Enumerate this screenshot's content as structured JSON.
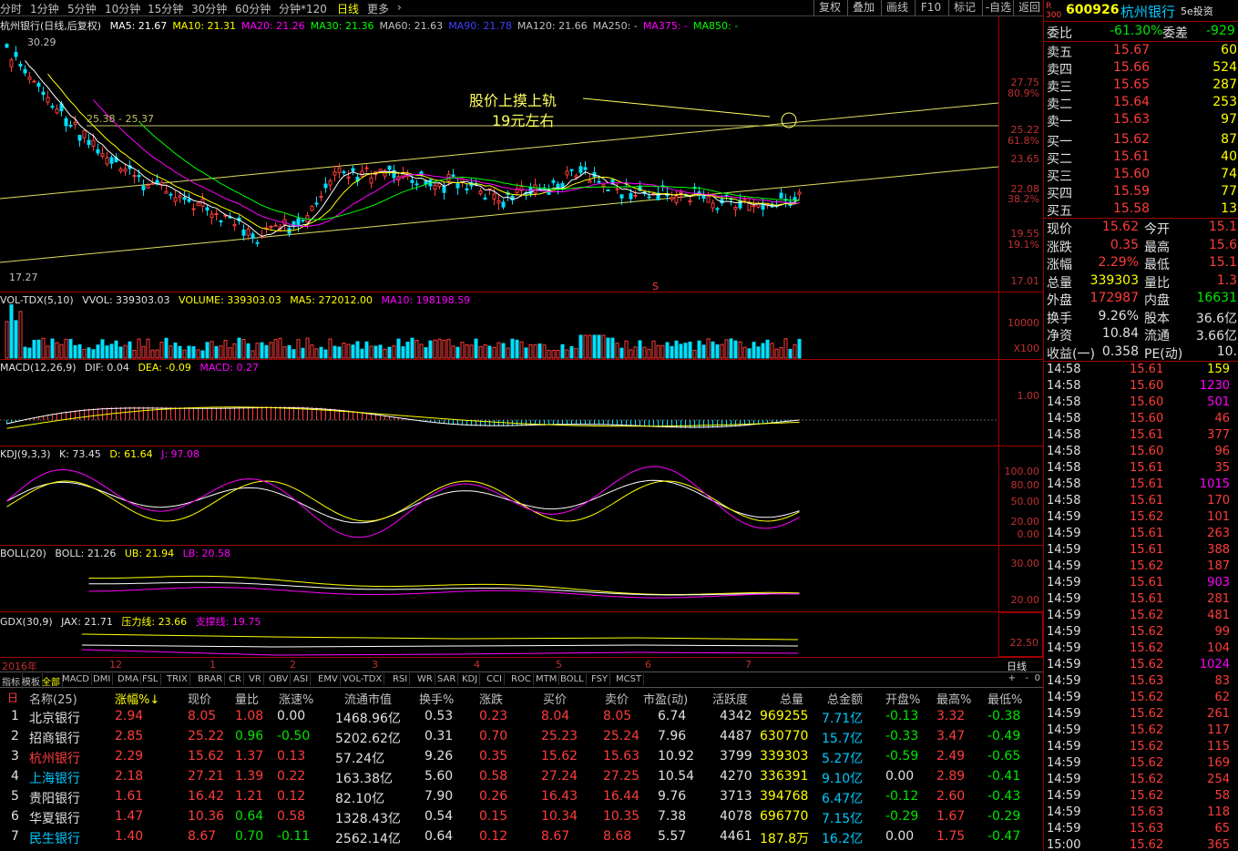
{
  "periods": [
    "分时",
    "1分钟",
    "5分钟",
    "10分钟",
    "15分钟",
    "30分钟",
    "60分钟",
    "分钟*120",
    "日线",
    "更多"
  ],
  "active_period": "日线",
  "toolbar_right": [
    "复权",
    "叠加",
    "画线",
    "F10",
    "标记",
    "-自选",
    "返回"
  ],
  "main_panel": {
    "stock_label": "杭州银行(日线,后复权)",
    "ma": [
      {
        "name": "MA5",
        "value": "21.67",
        "color": "#ffffff"
      },
      {
        "name": "MA10",
        "value": "21.31",
        "color": "#ffff00"
      },
      {
        "name": "MA20",
        "value": "21.26",
        "color": "#ff00ff"
      },
      {
        "name": "MA30",
        "value": "21.36",
        "color": "#00ff00"
      },
      {
        "name": "MA60",
        "value": "21.63",
        "color": "#c0c0c0"
      },
      {
        "name": "MA90",
        "value": "21.78",
        "color": "#4040ff"
      },
      {
        "name": "MA120",
        "value": "21.66",
        "color": "#c0c0c0"
      },
      {
        "name": "MA250",
        "value": "-",
        "color": "#c0c0c0"
      },
      {
        "name": "MA375",
        "value": "-",
        "color": "#ff00ff"
      },
      {
        "name": "MA850",
        "value": "-",
        "color": "#00ff00"
      }
    ],
    "high_label": "30.29",
    "low_label": "17.27",
    "range_label": "25.38 - 25.37",
    "annotation_line1": "股价上摸上轨",
    "annotation_line2": "19元左右",
    "axis": [
      "27.75",
      "80.9%",
      "25.22",
      "61.8%",
      "23.65",
      "22.08",
      "38.2%",
      "19.55",
      "19.1%",
      "17.01"
    ]
  },
  "vol_panel": {
    "label": "VOL-TDX(5,10)",
    "vvol": "VVOL: 339303.03",
    "volume": "VOLUME: 339303.03",
    "ma5": "MA5: 272012.00",
    "ma10": "MA10: 198198.59",
    "axis": [
      "10000",
      "X100"
    ]
  },
  "macd_panel": {
    "label": "MACD(12,26,9)",
    "dif": "DIF: 0.04",
    "dea": "DEA: -0.09",
    "macd": "MACD: 0.27",
    "axis": [
      "1.00"
    ]
  },
  "kdj_panel": {
    "label": "KDJ(9,3,3)",
    "k": "K: 73.45",
    "d": "D: 61.64",
    "j": "J: 97.08",
    "axis": [
      "100.00",
      "80.00",
      "50.00",
      "20.00",
      "0.00"
    ]
  },
  "boll_panel": {
    "label": "BOLL(20)",
    "boll": "BOLL: 21.26",
    "ub": "UB: 21.94",
    "lb": "LB: 20.58",
    "axis": [
      "30.00",
      "20.00"
    ]
  },
  "gdx_panel": {
    "label": "GDX(30,9)",
    "jax": "JAX: 21.71",
    "pressure": "压力线: 23.66",
    "support": "支撑线: 19.75",
    "axis": [
      "22.50"
    ]
  },
  "date_axis": [
    "2016年",
    "12",
    "1",
    "2",
    "3",
    "4",
    "5",
    "6",
    "7"
  ],
  "date_axis_right": "日线",
  "indicator_tabs": [
    "指标",
    "模板",
    "全部",
    "MACD",
    "DMI",
    "DMA",
    "FSL",
    "TRIX",
    "BRAR",
    "CR",
    "VR",
    "OBV",
    "ASI",
    "EMV",
    "VOL-TDX",
    "RSI",
    "WR",
    "SAR",
    "KDJ",
    "CCI",
    "ROC",
    "MTM",
    "BOLL",
    "FSY",
    "MCST"
  ],
  "active_tab": "全部",
  "table": {
    "headers": [
      "名称(25)",
      "涨幅%↓",
      "现价",
      "量比",
      "涨速%",
      "流通市值",
      "换手%",
      "涨跌",
      "买价",
      "卖价",
      "市盈(动)",
      "活跃度",
      "总量",
      "总金额",
      "开盘%",
      "最高%",
      "最低%"
    ],
    "rows": [
      {
        "idx": "1",
        "name": "北京银行",
        "chg": "2.94",
        "price": "8.05",
        "lb": "1.08",
        "speed": "0.00",
        "mv": "1468.96亿",
        "turn": "0.53",
        "diff": "0.23",
        "bid": "8.04",
        "ask": "8.05",
        "pe": "6.74",
        "act": "4342",
        "vol": "969255",
        "amt": "7.71亿",
        "open": "-0.13",
        "high": "3.32",
        "low": "-0.38"
      },
      {
        "idx": "2",
        "name": "招商银行",
        "chg": "2.85",
        "price": "25.22",
        "lb": "0.96",
        "speed": "-0.50",
        "mv": "5202.62亿",
        "turn": "0.31",
        "diff": "0.70",
        "bid": "25.23",
        "ask": "25.24",
        "pe": "7.96",
        "act": "4487",
        "vol": "630770",
        "amt": "15.7亿",
        "open": "-0.33",
        "high": "3.47",
        "low": "-0.49"
      },
      {
        "idx": "3",
        "name": "杭州银行",
        "chg": "2.29",
        "price": "15.62",
        "lb": "1.37",
        "speed": "0.13",
        "mv": "57.24亿",
        "turn": "9.26",
        "diff": "0.35",
        "bid": "15.62",
        "ask": "15.63",
        "pe": "10.92",
        "act": "3799",
        "vol": "339303",
        "amt": "5.27亿",
        "open": "-0.59",
        "high": "2.49",
        "low": "-0.65"
      },
      {
        "idx": "4",
        "name": "上海银行",
        "chg": "2.18",
        "price": "27.21",
        "lb": "1.39",
        "speed": "0.22",
        "mv": "163.38亿",
        "turn": "5.60",
        "diff": "0.58",
        "bid": "27.24",
        "ask": "27.25",
        "pe": "10.54",
        "act": "4270",
        "vol": "336391",
        "amt": "9.10亿",
        "open": "0.00",
        "high": "2.89",
        "low": "-0.41"
      },
      {
        "idx": "5",
        "name": "贵阳银行",
        "chg": "1.61",
        "price": "16.42",
        "lb": "1.21",
        "speed": "0.12",
        "mv": "82.10亿",
        "turn": "7.90",
        "diff": "0.26",
        "bid": "16.43",
        "ask": "16.44",
        "pe": "9.76",
        "act": "3713",
        "vol": "394768",
        "amt": "6.47亿",
        "open": "-0.12",
        "high": "2.60",
        "low": "-0.43"
      },
      {
        "idx": "6",
        "name": "华夏银行",
        "chg": "1.47",
        "price": "10.36",
        "lb": "0.64",
        "speed": "0.58",
        "mv": "1328.43亿",
        "turn": "0.54",
        "diff": "0.15",
        "bid": "10.34",
        "ask": "10.35",
        "pe": "7.38",
        "act": "4078",
        "vol": "696770",
        "amt": "7.15亿",
        "open": "-0.29",
        "high": "1.67",
        "low": "-0.29"
      },
      {
        "idx": "7",
        "name": "民生银行",
        "chg": "1.40",
        "price": "8.67",
        "lb": "0.70",
        "speed": "-0.11",
        "mv": "2562.14亿",
        "turn": "0.64",
        "diff": "0.12",
        "bid": "8.67",
        "ask": "8.68",
        "pe": "5.57",
        "act": "4461",
        "vol": "187.8万",
        "amt": "16.2亿",
        "open": "0.00",
        "high": "1.75",
        "low": "-0.47"
      }
    ]
  },
  "quote": {
    "code": "600926",
    "name": "杭州银行",
    "watermark": "5e投资",
    "weibi_label": "委比",
    "weibi": "-61.30%",
    "weicha_label": "委差",
    "weicha": "-929",
    "asks": [
      {
        "label": "卖五",
        "price": "15.67",
        "vol": "60"
      },
      {
        "label": "卖四",
        "price": "15.66",
        "vol": "524"
      },
      {
        "label": "卖三",
        "price": "15.65",
        "vol": "287"
      },
      {
        "label": "卖二",
        "price": "15.64",
        "vol": "253"
      },
      {
        "label": "卖一",
        "price": "15.63",
        "vol": "97"
      }
    ],
    "bids": [
      {
        "label": "买一",
        "price": "15.62",
        "vol": "87"
      },
      {
        "label": "买二",
        "price": "15.61",
        "vol": "40"
      },
      {
        "label": "买三",
        "price": "15.60",
        "vol": "74"
      },
      {
        "label": "买四",
        "price": "15.59",
        "vol": "77"
      },
      {
        "label": "买五",
        "price": "15.58",
        "vol": "13"
      }
    ],
    "stats": [
      {
        "l1": "现价",
        "v1": "15.62",
        "l2": "今开",
        "v2": "15.1",
        "c1": "red",
        "c2": "red"
      },
      {
        "l1": "涨跌",
        "v1": "0.35",
        "l2": "最高",
        "v2": "15.6",
        "c1": "red",
        "c2": "red"
      },
      {
        "l1": "涨幅",
        "v1": "2.29%",
        "l2": "最低",
        "v2": "15.1",
        "c1": "red",
        "c2": "red"
      },
      {
        "l1": "总量",
        "v1": "339303",
        "l2": "量比",
        "v2": "1.3",
        "c1": "yellow",
        "c2": "red"
      },
      {
        "l1": "外盘",
        "v1": "172987",
        "l2": "内盘",
        "v2": "16631",
        "c1": "red",
        "c2": "green"
      },
      {
        "l1": "换手",
        "v1": "9.26%",
        "l2": "股本",
        "v2": "36.6亿",
        "c1": "white",
        "c2": "white"
      },
      {
        "l1": "净资",
        "v1": "10.84",
        "l2": "流通",
        "v2": "3.66亿",
        "c1": "white",
        "c2": "white"
      },
      {
        "l1": "收益(一)",
        "v1": "0.358",
        "l2": "PE(动)",
        "v2": "10.",
        "c1": "white",
        "c2": "white"
      }
    ],
    "ticks": [
      [
        "14:58",
        "15.61",
        "159",
        "yellow"
      ],
      [
        "14:58",
        "15.60",
        "1230",
        "magenta"
      ],
      [
        "14:58",
        "15.60",
        "501",
        "magenta"
      ],
      [
        "14:58",
        "15.60",
        "46",
        "red"
      ],
      [
        "14:58",
        "15.61",
        "377",
        "red"
      ],
      [
        "14:58",
        "15.60",
        "96",
        "red"
      ],
      [
        "14:58",
        "15.61",
        "35",
        "red"
      ],
      [
        "14:58",
        "15.61",
        "1015",
        "magenta"
      ],
      [
        "14:58",
        "15.61",
        "170",
        "red"
      ],
      [
        "14:59",
        "15.62",
        "101",
        "red"
      ],
      [
        "14:59",
        "15.61",
        "263",
        "red"
      ],
      [
        "14:59",
        "15.61",
        "388",
        "red"
      ],
      [
        "14:59",
        "15.62",
        "187",
        "red"
      ],
      [
        "14:59",
        "15.61",
        "903",
        "magenta"
      ],
      [
        "14:59",
        "15.61",
        "281",
        "red"
      ],
      [
        "14:59",
        "15.62",
        "481",
        "red"
      ],
      [
        "14:59",
        "15.62",
        "99",
        "red"
      ],
      [
        "14:59",
        "15.62",
        "104",
        "red"
      ],
      [
        "14:59",
        "15.62",
        "1024",
        "magenta"
      ],
      [
        "14:59",
        "15.63",
        "83",
        "red"
      ],
      [
        "14:59",
        "15.62",
        "62",
        "red"
      ],
      [
        "14:59",
        "15.62",
        "261",
        "red"
      ],
      [
        "14:59",
        "15.62",
        "117",
        "red"
      ],
      [
        "14:59",
        "15.62",
        "115",
        "red"
      ],
      [
        "14:59",
        "15.62",
        "169",
        "red"
      ],
      [
        "14:59",
        "15.62",
        "254",
        "red"
      ],
      [
        "14:59",
        "15.62",
        "58",
        "red"
      ],
      [
        "14:59",
        "15.63",
        "118",
        "red"
      ],
      [
        "14:59",
        "15.63",
        "65",
        "red"
      ],
      [
        "15:00",
        "15.62",
        "365",
        "red"
      ]
    ]
  }
}
